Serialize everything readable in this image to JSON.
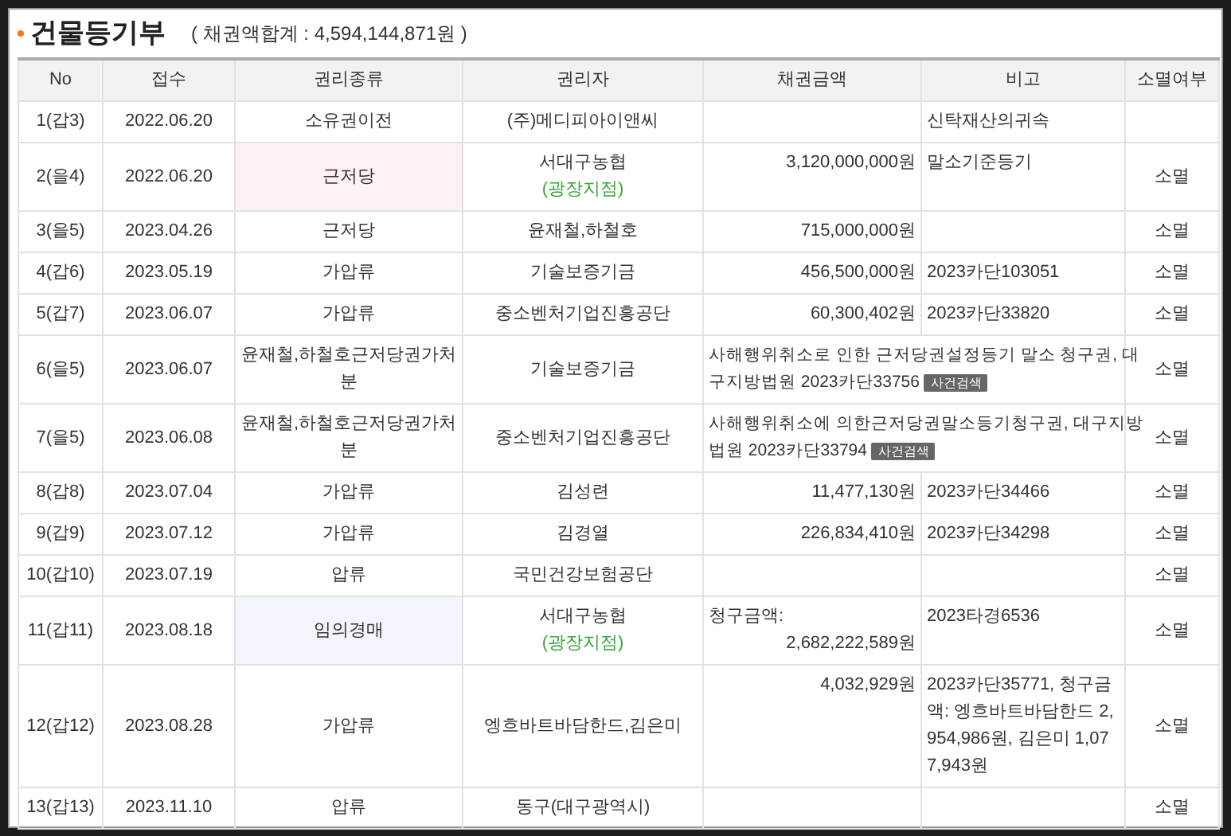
{
  "title": "건물등기부",
  "total": "( 채권액합계 : 4,594,144,871원 )",
  "columns": [
    "No",
    "접수",
    "권리종류",
    "권리자",
    "채권금액",
    "비고",
    "소멸여부"
  ],
  "rows": [
    {
      "kind": "normal",
      "no": "1(갑3)",
      "date": "2022.06.20",
      "right": "소유권이전",
      "holder": "(주)메디피아이앤씨",
      "note": "신탁재산의귀속"
    },
    {
      "kind": "normal",
      "no": "2(을4)",
      "date": "2022.06.20",
      "right": "근저당",
      "color": "#fdf1f1",
      "holder": "서대구농협",
      "branch": "(광장지점)",
      "amount": "3,120,000,000원",
      "note": "말소기준등기",
      "status": "소멸"
    },
    {
      "kind": "normal",
      "no": "3(을5)",
      "date": "2023.04.26",
      "right": "근저당",
      "holder": "윤재철,하철호",
      "amount": "715,000,000원",
      "status": "소멸"
    },
    {
      "kind": "normal",
      "no": "4(갑6)",
      "date": "2023.05.19",
      "right": "가압류",
      "holder": "기술보증기금",
      "amount": "456,500,000원",
      "note": "2023카단103051",
      "status": "소멸"
    },
    {
      "kind": "normal",
      "no": "5(갑7)",
      "date": "2023.06.07",
      "right": "가압류",
      "holder": "중소벤처기업진흥공단",
      "amount": "60,300,402원",
      "note": "2023카단33820",
      "status": "소멸"
    },
    {
      "kind": "wide_note",
      "no": "6(을5)",
      "date": "2023.06.07",
      "right": "윤재철,하철호근저당권가처분",
      "holder": "기술보증기금",
      "note_lines": [
        "사해행위취소로 인한 근저당권설정등기 말소 청구권, 대",
        "구지방법원 2023카단33756"
      ],
      "badge": "사건검색",
      "status": "소멸"
    },
    {
      "kind": "wide_note",
      "no": "7(을5)",
      "date": "2023.06.08",
      "right": "윤재철,하철호근저당권가처분",
      "holder": "중소벤처기업진흥공단",
      "note_lines": [
        "사해행위취소에 의한근저당권말소등기청구권, 대구지방",
        "법원 2023카단33794"
      ],
      "badge": "사건검색",
      "status": "소멸"
    },
    {
      "kind": "normal",
      "no": "8(갑8)",
      "date": "2023.07.04",
      "right": "가압류",
      "holder": "김성련",
      "amount": "11,477,130원",
      "note": "2023카단34466",
      "status": "소멸"
    },
    {
      "kind": "normal",
      "no": "9(갑9)",
      "date": "2023.07.12",
      "right": "가압류",
      "holder": "김경열",
      "amount": "226,834,410원",
      "note": "2023카단34298",
      "status": "소멸"
    },
    {
      "kind": "normal",
      "no": "10(갑10)",
      "date": "2023.07.19",
      "right": "압류",
      "holder": "국민건강보험공단",
      "status": "소멸"
    },
    {
      "kind": "normal",
      "no": "11(갑11)",
      "date": "2023.08.18",
      "right": "임의경매",
      "color": "#f3f5fd",
      "holder": "서대구농협",
      "branch": "(광장지점)",
      "amount_label": "청구금액:",
      "amount": "2,682,222,589원",
      "note": "2023타경6536",
      "status": "소멸"
    },
    {
      "kind": "normal",
      "no": "12(갑12)",
      "date": "2023.08.28",
      "right": "가압류",
      "holder": "엥흐바트바담한드,김은미",
      "amount": "4,032,929원",
      "note": "2023카단35771, 청구금액: 엥흐바트바담한드 2,954,986원, 김은미 1,077,943원",
      "status": "소멸"
    },
    {
      "kind": "normal",
      "no": "13(갑13)",
      "date": "2023.11.10",
      "right": "압류",
      "holder": "동구(대구광역시)",
      "status": "소멸"
    }
  ]
}
